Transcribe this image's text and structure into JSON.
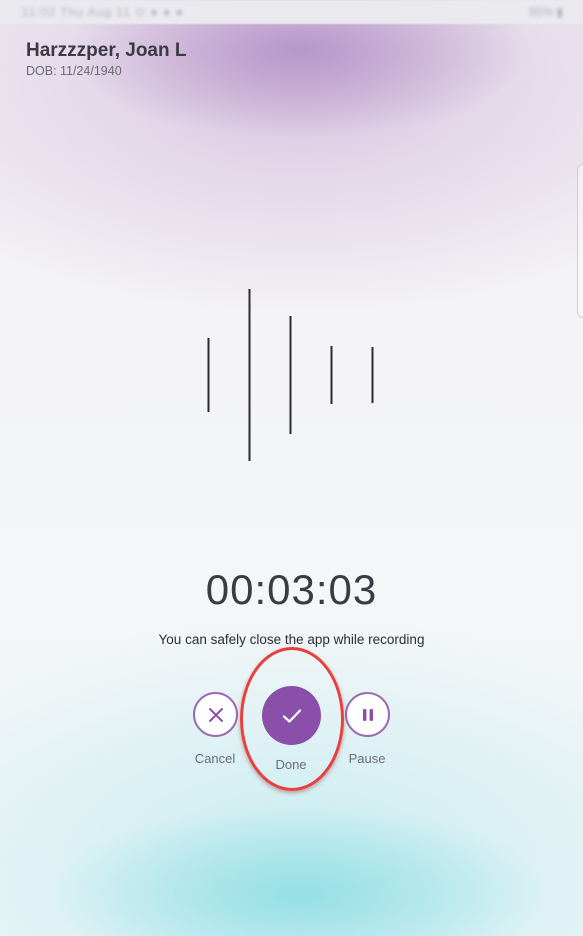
{
  "status_bar": {
    "left_text": "11:02 Thu Aug 11 ⊙ ● ● ●",
    "right_text": "95% ▮"
  },
  "patient": {
    "name": "Harzzzper, Joan L",
    "dob": "DOB: 11/24/1940"
  },
  "recording": {
    "timer": "00:03:03",
    "info": "You can safely close the app while recording"
  },
  "controls": {
    "cancel_label": "Cancel",
    "done_label": "Done",
    "pause_label": "Pause",
    "cancel_icon": "close-icon",
    "done_icon": "checkmark-icon",
    "pause_icon": "pause-icon"
  },
  "colors": {
    "accent": "#8a4fa8",
    "highlight": "#e8403f",
    "text_primary": "#3b3b44"
  }
}
